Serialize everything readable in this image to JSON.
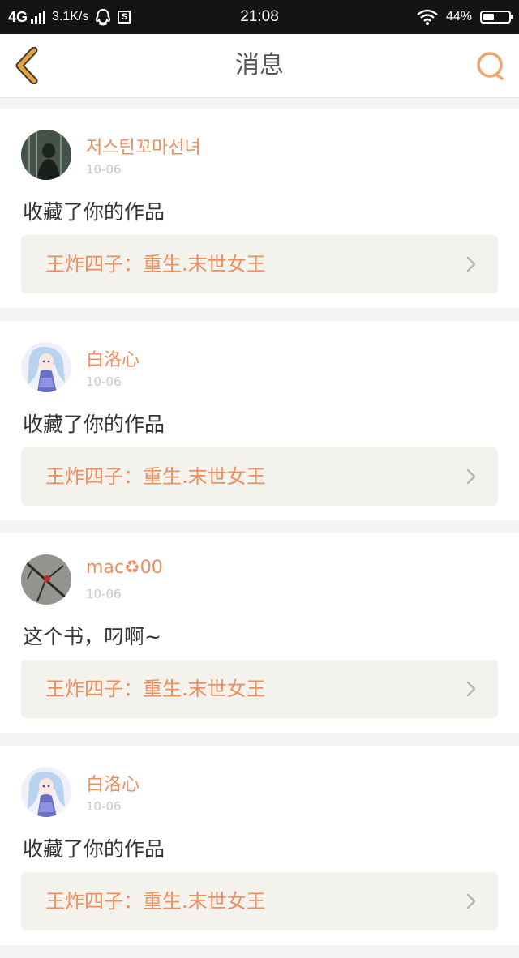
{
  "status_bar": {
    "network": "4G",
    "speed": "3.1K/s",
    "time": "21:08",
    "battery_percent": "44%",
    "battery_level": 0.44
  },
  "header": {
    "title": "消息",
    "accent_color": "#e8a33c",
    "search_color": "#f2a36a"
  },
  "messages": [
    {
      "username": "저스틴꼬마선녀",
      "date": "10-06",
      "text": "收藏了你的作品",
      "work_title": "王炸四子：重生.末世女王",
      "avatar": "avatar-dark-figure"
    },
    {
      "username": "白洛心",
      "date": "10-06",
      "text": "收藏了你的作品",
      "work_title": "王炸四子：重生.末世女王",
      "avatar": "avatar-anime-girl"
    },
    {
      "username": "mac♻00",
      "date": "10-06",
      "text": "这个书，叼啊~",
      "work_title": "王炸四子：重生.末世女王",
      "avatar": "avatar-branch-red"
    },
    {
      "username": "白洛心",
      "date": "10-06",
      "text": "收藏了你的作品",
      "work_title": "王炸四子：重生.末世女王",
      "avatar": "avatar-anime-girl"
    }
  ]
}
